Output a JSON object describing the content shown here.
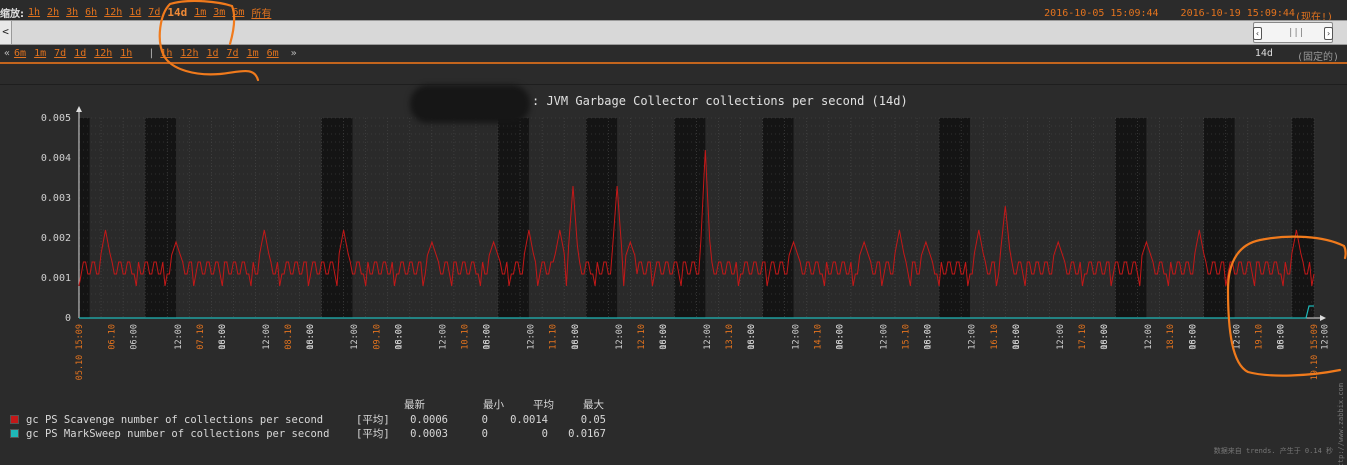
{
  "filter": {
    "zoom_label": "缩放:",
    "zoom_links": [
      "1h",
      "2h",
      "3h",
      "6h",
      "12h",
      "1d",
      "7d",
      "14d",
      "1m",
      "3m",
      "6m",
      "所有"
    ],
    "active_zoom": "14d",
    "date_from": "2016-10-05 15:09:44",
    "date_to": "2016-10-19 15:09:44",
    "now_label": "(现在!)",
    "nav_back_links": [
      "6m",
      "1m",
      "7d",
      "1d",
      "12h",
      "1h"
    ],
    "nav_fwd_links": [
      "1h",
      "12h",
      "1d",
      "7d",
      "1m",
      "6m"
    ],
    "nav_back_arrow": "«",
    "nav_fwd_arrow": "»",
    "nav_divider": "|",
    "period_length": "14d",
    "period_fixed": "(固定的)",
    "scroll_left_arrow": "<"
  },
  "graph": {
    "title": ": JVM Garbage Collector collections per second (14d)",
    "colors": {
      "scavenge": "#c41818",
      "marksweep": "#1fb8b8",
      "accent": "#e3731e",
      "plot_bg": "#2a2a2a",
      "night_band": "#141414"
    }
  },
  "chart_data": {
    "type": "line",
    "title": ": JVM Garbage Collector collections per second (14d)",
    "ylim": [
      0,
      0.005
    ],
    "yticks": [
      "0",
      "0.001",
      "0.002",
      "0.003",
      "0.004",
      "0.005"
    ],
    "xlabels_days": [
      "05.10 15:09",
      "06.10",
      "07.10",
      "08.10",
      "09.10",
      "10.10",
      "11.10",
      "12.10",
      "13.10",
      "14.10",
      "15.10",
      "16.10",
      "17.10",
      "18.10",
      "19.10",
      "19.10 15:09"
    ],
    "xlabels_hours": [
      "06:00",
      "12:00",
      "18:00"
    ],
    "grid": true,
    "series": [
      {
        "name": "gc PS Scavenge number of collections per second",
        "baseline": 0.0014,
        "spikes": [
          [
            0.3,
            0.0022
          ],
          [
            1.1,
            0.0019
          ],
          [
            2.1,
            0.0022
          ],
          [
            3.0,
            0.0022
          ],
          [
            4.0,
            0.0019
          ],
          [
            4.7,
            0.0019
          ],
          [
            5.1,
            0.0022
          ],
          [
            5.45,
            0.0022
          ],
          [
            5.6,
            0.0033
          ],
          [
            6.1,
            0.0033
          ],
          [
            6.25,
            0.0019
          ],
          [
            7.1,
            0.0042
          ],
          [
            8.1,
            0.0019
          ],
          [
            8.9,
            0.0019
          ],
          [
            9.3,
            0.0022
          ],
          [
            9.6,
            0.0019
          ],
          [
            10.2,
            0.0022
          ],
          [
            10.5,
            0.0028
          ],
          [
            11.1,
            0.0019
          ],
          [
            12.1,
            0.0019
          ],
          [
            12.7,
            0.0022
          ],
          [
            13.8,
            0.0022
          ],
          [
            14.1,
            0.0019
          ]
        ],
        "drop_at": 14.55,
        "last": 0.0006
      },
      {
        "name": "gc PS MarkSweep number of collections per second",
        "baseline": 0,
        "last": 0.0003
      }
    ]
  },
  "legend": {
    "headers": [
      "最新",
      "最小",
      "平均",
      "最大"
    ],
    "rows": [
      {
        "name": "gc PS Scavenge number of collections per second",
        "func": "[平均]",
        "last": "0.0006",
        "min": "0",
        "avg": "0.0014",
        "max": "0.05"
      },
      {
        "name": "gc PS MarkSweep number of collections per second",
        "func": "[平均]",
        "last": "0.0003",
        "min": "0",
        "avg": "0",
        "max": "0.0167"
      }
    ]
  },
  "footer": {
    "note": "数据来自 trends. 产生于 0.14 秒",
    "side_url": "http://www.zabbix.com"
  }
}
